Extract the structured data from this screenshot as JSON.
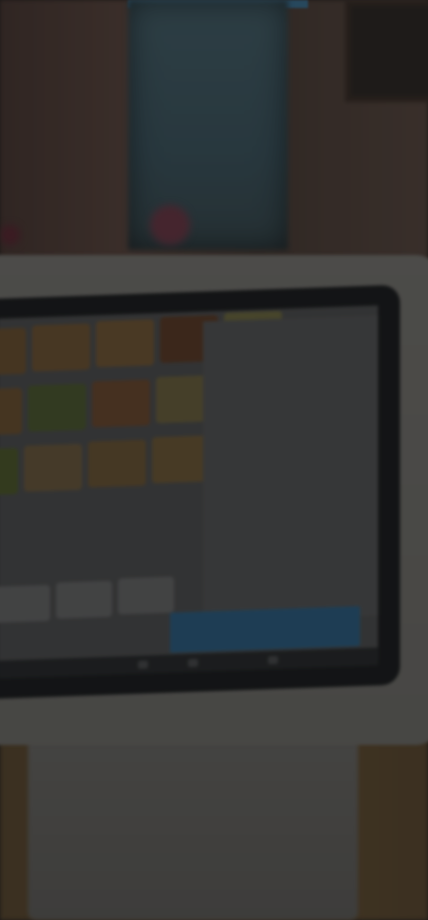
{
  "colors": {
    "overlay": "#000000",
    "charge_button": "#2f5f82",
    "wall": "#4a3a36"
  },
  "scene": {
    "description_icons": [
      "pos-terminal-icon"
    ]
  },
  "pos": {
    "menu_items": [
      {
        "label": ""
      },
      {
        "label": ""
      },
      {
        "label": ""
      },
      {
        "label": ""
      },
      {
        "label": ""
      },
      {
        "label": ""
      },
      {
        "label": ""
      },
      {
        "label": ""
      },
      {
        "label": ""
      },
      {
        "label": ""
      },
      {
        "label": ""
      },
      {
        "label": ""
      },
      {
        "label": ""
      },
      {
        "label": ""
      },
      {
        "label": ""
      }
    ],
    "cart_rows": [
      {
        "name": "",
        "price": ""
      },
      {
        "name": "",
        "price": ""
      },
      {
        "name": "",
        "price": ""
      },
      {
        "name": "",
        "price": ""
      },
      {
        "name": "",
        "price": ""
      },
      {
        "name": "",
        "price": ""
      },
      {
        "name": "",
        "price": ""
      }
    ],
    "charge_label": ""
  }
}
